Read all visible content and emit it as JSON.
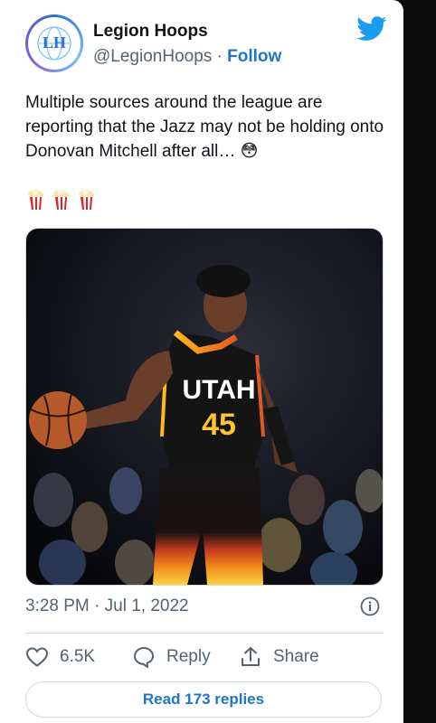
{
  "account": {
    "name": "Legion Hoops",
    "handle": "@LegionHoops",
    "separator": "·",
    "follow_label": "Follow",
    "avatar_text": "LH"
  },
  "tweet": {
    "text": "Multiple sources around the league are reporting that the Jazz may not be holding onto Donovan Mitchell after all… 😳",
    "emojis": "🍿🍿🍿",
    "image": {
      "jersey_text": "UTAH",
      "jersey_number": "45"
    },
    "timestamp": "3:28 PM · Jul 1, 2022"
  },
  "actions": {
    "likes": "6.5K",
    "reply_label": "Reply",
    "share_label": "Share"
  },
  "read_replies_label": "Read 173 replies",
  "colors": {
    "accent": "#1d76c7",
    "twitter_blue": "#1d9bf0",
    "secondary_text": "#536471"
  }
}
